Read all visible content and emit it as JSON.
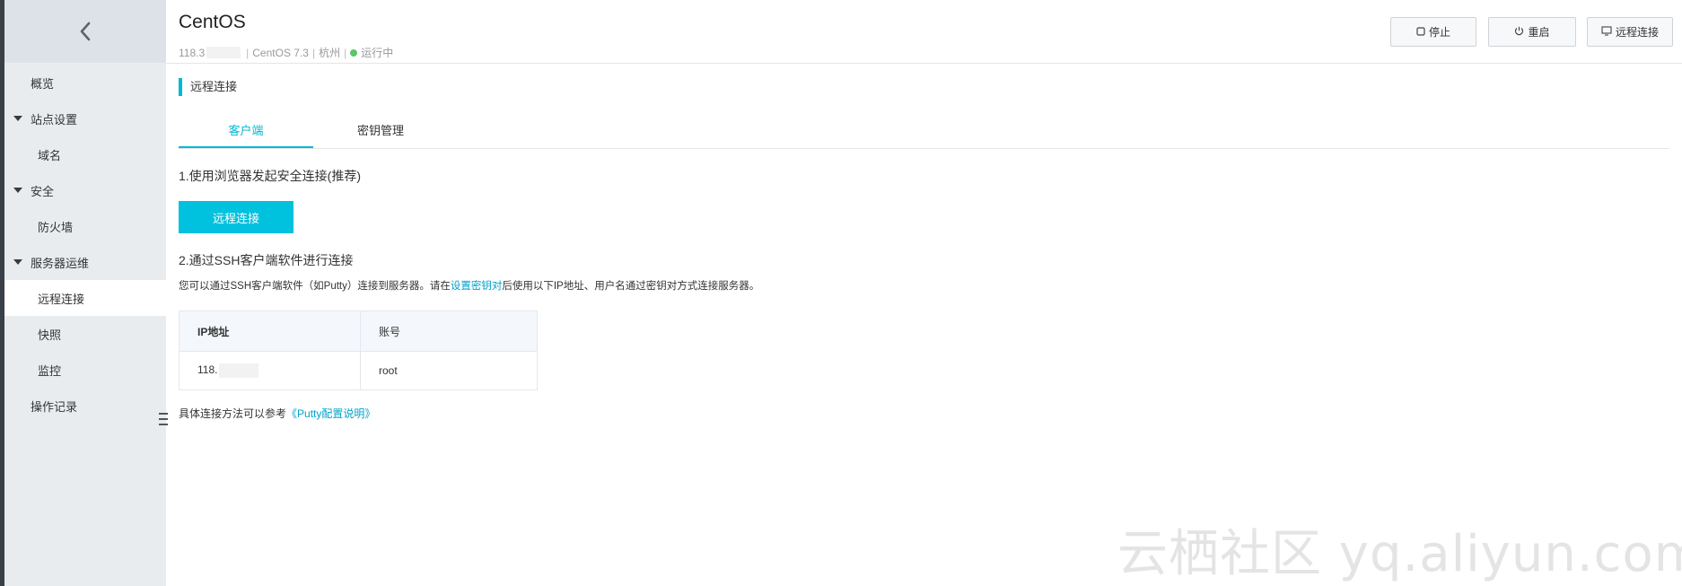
{
  "header": {
    "title": "CentOS",
    "ip_prefix": "118.3",
    "os": "CentOS 7.3",
    "region": "杭州",
    "status": "运行中",
    "status_color": "#5cc56a",
    "buttons": {
      "stop": "停止",
      "restart": "重启",
      "remote": "远程连接"
    }
  },
  "sidebar": {
    "back_icon": "chevron-left-icon",
    "items": [
      {
        "label": "概览",
        "level": 1
      },
      {
        "label": "站点设置",
        "level": "group"
      },
      {
        "label": "域名",
        "level": 2
      },
      {
        "label": "安全",
        "level": "group"
      },
      {
        "label": "防火墙",
        "level": 2
      },
      {
        "label": "服务器运维",
        "level": "group"
      },
      {
        "label": "远程连接",
        "level": 2,
        "active": true
      },
      {
        "label": "快照",
        "level": 2
      },
      {
        "label": "监控",
        "level": 2
      },
      {
        "label": "操作记录",
        "level": 1
      }
    ]
  },
  "main": {
    "section_title": "远程连接",
    "tabs": [
      {
        "label": "客户端",
        "active": true
      },
      {
        "label": "密钥管理",
        "active": false
      }
    ],
    "step1": "1.使用浏览器发起安全连接(推荐)",
    "remote_button": "远程连接",
    "step2": "2.通过SSH客户端软件进行连接",
    "desc_before": "您可以通过SSH客户端软件（如Putty）连接到服务器。请在",
    "desc_link": "设置密钥对",
    "desc_after": "后使用以下IP地址、用户名通过密钥对方式连接服务器。",
    "table": {
      "headers": [
        "IP地址",
        "账号"
      ],
      "rows": [
        [
          "118.",
          "root"
        ]
      ]
    },
    "ref_before": "具体连接方法可以参考",
    "ref_link": "《Putty配置说明》"
  },
  "watermark": "云栖社区 yq.aliyun.com",
  "colors": {
    "accent": "#00c1de",
    "link": "#00a2ca",
    "sidebar_bg": "#e9ecef"
  }
}
